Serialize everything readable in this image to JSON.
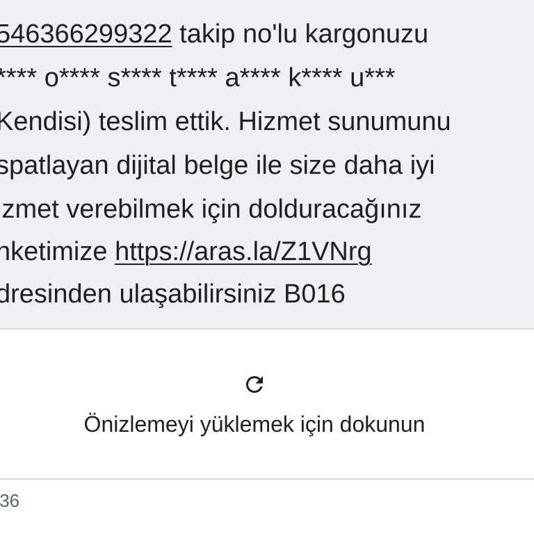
{
  "message": {
    "tracking_number": "546366299322",
    "line1_rest": " takip no'lu kargonuzu",
    "line2": "**** o**** s**** t**** a**** k**** u***",
    "line3": "Kendisi) teslim ettik. Hizmet sunumunu",
    "line4": "spatlayan dijital belge ile size daha iyi",
    "line5": "izmet verebilmek için dolduracağınız",
    "line6_prefix": "nketimize ",
    "link_url": "https://aras.la/Z1VNrg",
    "line7": "dresinden ulaşabilirsiniz B016"
  },
  "preview": {
    "icon": "reload-icon",
    "label": "Önizlemeyi yüklemek için dokunun"
  },
  "timestamp": ":36"
}
